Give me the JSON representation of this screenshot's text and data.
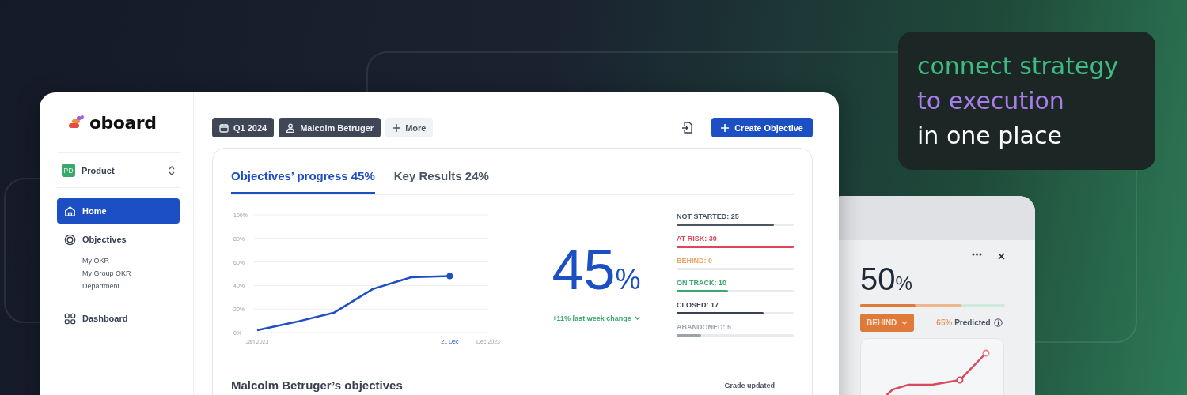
{
  "tagline": {
    "lines": [
      {
        "text": "connect strategy",
        "color": "#3dbb82"
      },
      {
        "text": "to execution",
        "color": "#a77ee8"
      },
      {
        "text": "in one place",
        "color": "#ffffff"
      }
    ]
  },
  "app": {
    "logo": "oboard",
    "workspace": {
      "badge": "PD",
      "name": "Product"
    },
    "nav": [
      {
        "label": "Home",
        "selected": true
      },
      {
        "label": "Objectives",
        "selected": false,
        "children": [
          {
            "label": "My OKR",
            "selected": false
          },
          {
            "label": "My Group OKR",
            "selected": false
          },
          {
            "label": "Department",
            "selected": false
          }
        ]
      },
      {
        "label": "Dashboard",
        "selected": false
      }
    ],
    "toolbar": {
      "filters": [
        {
          "kind": "period",
          "label": "Q1 2024"
        },
        {
          "kind": "user",
          "label": "Malcolm Betruger"
        },
        {
          "kind": "more",
          "label": "More"
        }
      ],
      "create_button": "Create Objective"
    },
    "tabs": [
      {
        "label": "Objectives’ progress 45%",
        "selected": true
      },
      {
        "label": "Key Results 24%",
        "selected": false
      }
    ],
    "chart_data": {
      "type": "line",
      "categories": [
        "Jan 2023",
        null,
        null,
        null,
        null,
        "21 Dec",
        "Dec 2023"
      ],
      "series": [
        {
          "color": "#1d4fc4",
          "values": [
            2,
            9,
            17,
            37,
            47,
            48,
            null
          ]
        }
      ],
      "ylim": [
        0,
        100
      ],
      "grid": true,
      "yticks": [
        {
          "value": 0,
          "label": "0%"
        },
        {
          "value": 20,
          "label": "20%"
        },
        {
          "value": 40,
          "label": "40%"
        },
        {
          "value": 60,
          "label": "60%"
        },
        {
          "value": 80,
          "label": "80%"
        },
        {
          "value": 100,
          "label": "100%"
        }
      ]
    },
    "progress": {
      "value": "45",
      "unit": "%",
      "change": "+11% last week change"
    },
    "statuses": [
      {
        "label": "NOT STARTED: 25",
        "level": 0.83,
        "color": "#4b5563"
      },
      {
        "label": "AT RISK: 30",
        "level": 1.0,
        "color": "#e0435a"
      },
      {
        "label": "BEHIND: 0",
        "level": 0,
        "color": "#f0a060"
      },
      {
        "label": "ON TRACK: 10",
        "level": 0.44,
        "color": "#3aa76d"
      },
      {
        "label": "CLOSED: 17",
        "level": 0.74,
        "color": "#374151"
      },
      {
        "label": "ABANDONED: 5",
        "level": 0.21,
        "color": "#9ca3af"
      }
    ],
    "objectives_title": "Malcolm Betruger’s objectives",
    "grade_label": "Grade updated"
  },
  "detail": {
    "value": "50",
    "unit": "%",
    "level": 0.38,
    "status": "BEHIND",
    "predicted_value": "65%",
    "predicted_label": "Predicted"
  }
}
